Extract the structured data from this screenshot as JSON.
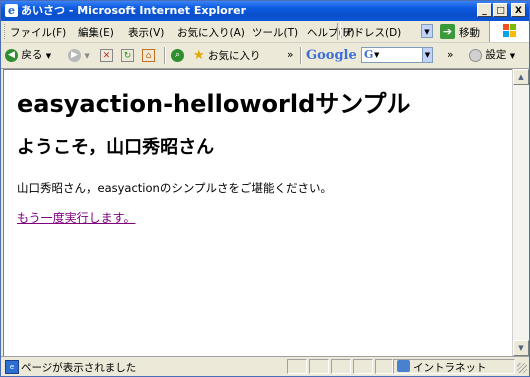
{
  "window": {
    "title": "あいさつ - Microsoft Internet Explorer",
    "minimize": "_",
    "maximize": "□",
    "close": "X"
  },
  "menu": {
    "items": [
      "ファイル(F)",
      "編集(E)",
      "表示(V)",
      "お気に入り(A)",
      "ツール(T)",
      "ヘルプ(H)"
    ],
    "address_label": "アドレス(D)",
    "go_label": "移動"
  },
  "toolbar": {
    "back_label": "戻る",
    "favorites_label": "お気に入り",
    "more_chevron": "»",
    "google_label": "Google",
    "google_more": "»",
    "settings_label": "設定"
  },
  "page": {
    "heading": "easyaction-helloworldサンプル",
    "greeting": "ようこそ，山口秀昭さん",
    "message": "山口秀昭さん，easyactionのシンプルさをご堪能ください。",
    "rerun_link": "もう一度実行します。"
  },
  "status": {
    "text": "ページが表示されました",
    "zone": "イントラネット"
  },
  "colors": {
    "titlebar": "#0c5be0",
    "chrome": "#ece9d8",
    "visited_link": "#800080"
  }
}
